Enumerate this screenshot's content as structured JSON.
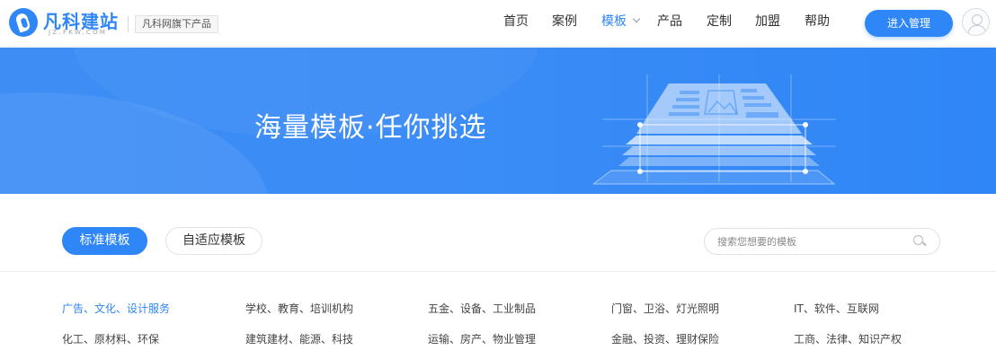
{
  "brand": {
    "name": "凡科建站",
    "domain": "JZ.FKW.COM",
    "product_tag": "凡科网旗下产品",
    "color": "#2f86f6"
  },
  "nav": {
    "items": [
      {
        "label": "首页"
      },
      {
        "label": "案例"
      },
      {
        "label": "模板",
        "active": true
      },
      {
        "label": "产品"
      },
      {
        "label": "定制"
      },
      {
        "label": "加盟"
      },
      {
        "label": "帮助"
      }
    ],
    "cta_label": "进入管理"
  },
  "banner": {
    "title": "海量模板·任你挑选",
    "background_color": "#3b8cf6"
  },
  "tabs": {
    "standard": "标准模板",
    "responsive": "自适应模板"
  },
  "search": {
    "placeholder": "搜索您想要的模板"
  },
  "categories": [
    [
      "广告、文化、设计服务",
      "学校、教育、培训机构",
      "五金、设备、工业制品",
      "门窗、卫浴、灯光照明",
      "IT、软件、互联网"
    ],
    [
      "化工、原材料、环保",
      "建筑建材、能源、科技",
      "运输、房产、物业管理",
      "金融、投资、理财保险",
      "工商、法律、知识产权"
    ]
  ]
}
